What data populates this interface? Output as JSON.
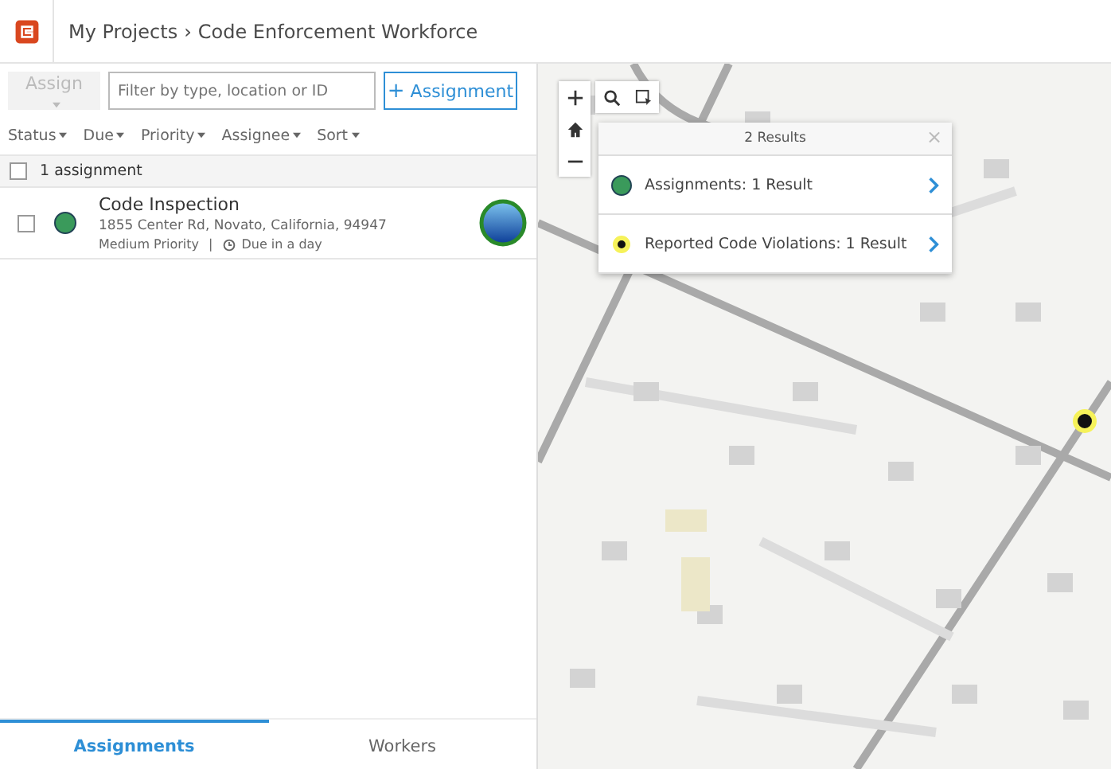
{
  "header": {
    "breadcrumb_root": "My Projects",
    "separator": "›",
    "project": "Code Enforcement Workforce"
  },
  "toolbar": {
    "assign_button": {
      "label": "Assign",
      "disabled": true
    },
    "filter": {
      "placeholder": "Filter by type, location or ID"
    },
    "add_button": {
      "icon": "+",
      "label": "Assignment"
    }
  },
  "filters": [
    "Status",
    "Due",
    "Priority",
    "Assignee",
    "Sort"
  ],
  "list_header": {
    "checked": false,
    "count": "1 assignment"
  },
  "assignments": [
    {
      "title": "Code Inspection",
      "address": "1855 Center Rd, Novato, California, 94947",
      "priority": "Medium Priority",
      "separator": "|",
      "due": "Due in a day",
      "checked": false,
      "color": "#3a9a5b"
    }
  ],
  "popup": {
    "title": "2 Results",
    "close": "×",
    "results": [
      {
        "kind": "assignment",
        "label": "Assignments: 1 Result"
      },
      {
        "kind": "violation",
        "label": "Reported Code Violations: 1 Result"
      }
    ]
  },
  "tabs": [
    {
      "label": "Assignments",
      "selected": true
    },
    {
      "label": "Workers",
      "selected": false
    }
  ]
}
